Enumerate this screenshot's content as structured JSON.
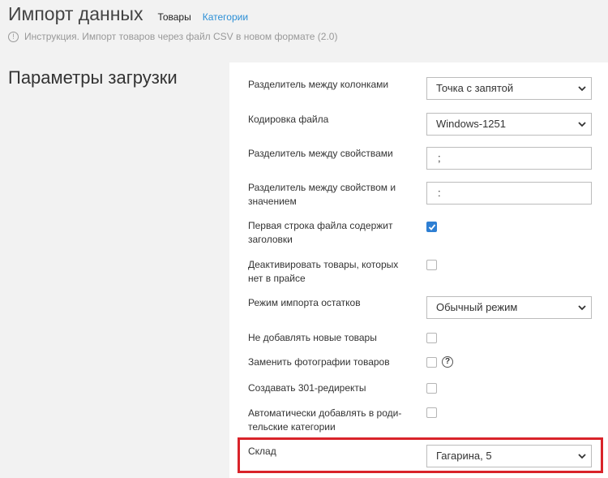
{
  "header": {
    "title": "Импорт данных",
    "tabs": [
      {
        "label": "Товары"
      },
      {
        "label": "Категории"
      }
    ],
    "help_text": "Инструкция. Импорт товаров через файл CSV в новом формате (2.0)",
    "help_icon": "info-icon"
  },
  "section_title": "Параметры загрузки",
  "form": {
    "column_separator": {
      "label": "Разделитель между колонками",
      "value": "Точка с запятой"
    },
    "encoding": {
      "label": "Кодировка файла",
      "value": "Windows-1251"
    },
    "property_separator": {
      "label": "Разделитель между свойствами",
      "value": ";"
    },
    "property_value_separator": {
      "label": "Разделитель между свойством и значением",
      "value": ":"
    },
    "first_row_headers": {
      "label": "Первая строка файла содержит заголовки",
      "checked": true
    },
    "deactivate_missing": {
      "label": "Деактивировать товары, которых нет в прайсе",
      "checked": false
    },
    "stock_mode": {
      "label": "Режим импорта остатков",
      "value": "Обычный режим"
    },
    "no_new_products": {
      "label": "Не добавлять новые товары",
      "checked": false
    },
    "replace_photos": {
      "label": "Заменить фотографии товаров",
      "checked": false,
      "help_icon": "question-icon"
    },
    "create_redirects": {
      "label": "Создавать 301-редиректы",
      "checked": false
    },
    "auto_parent_categories": {
      "label": "Автоматически добавлять в роди-тельские категории",
      "checked": false
    },
    "warehouse": {
      "label": "Склад",
      "value": "Гагарина, 5"
    }
  },
  "colors": {
    "accent": "#2e7fd3",
    "link": "#2c8fd6",
    "highlight": "#d9232a"
  }
}
